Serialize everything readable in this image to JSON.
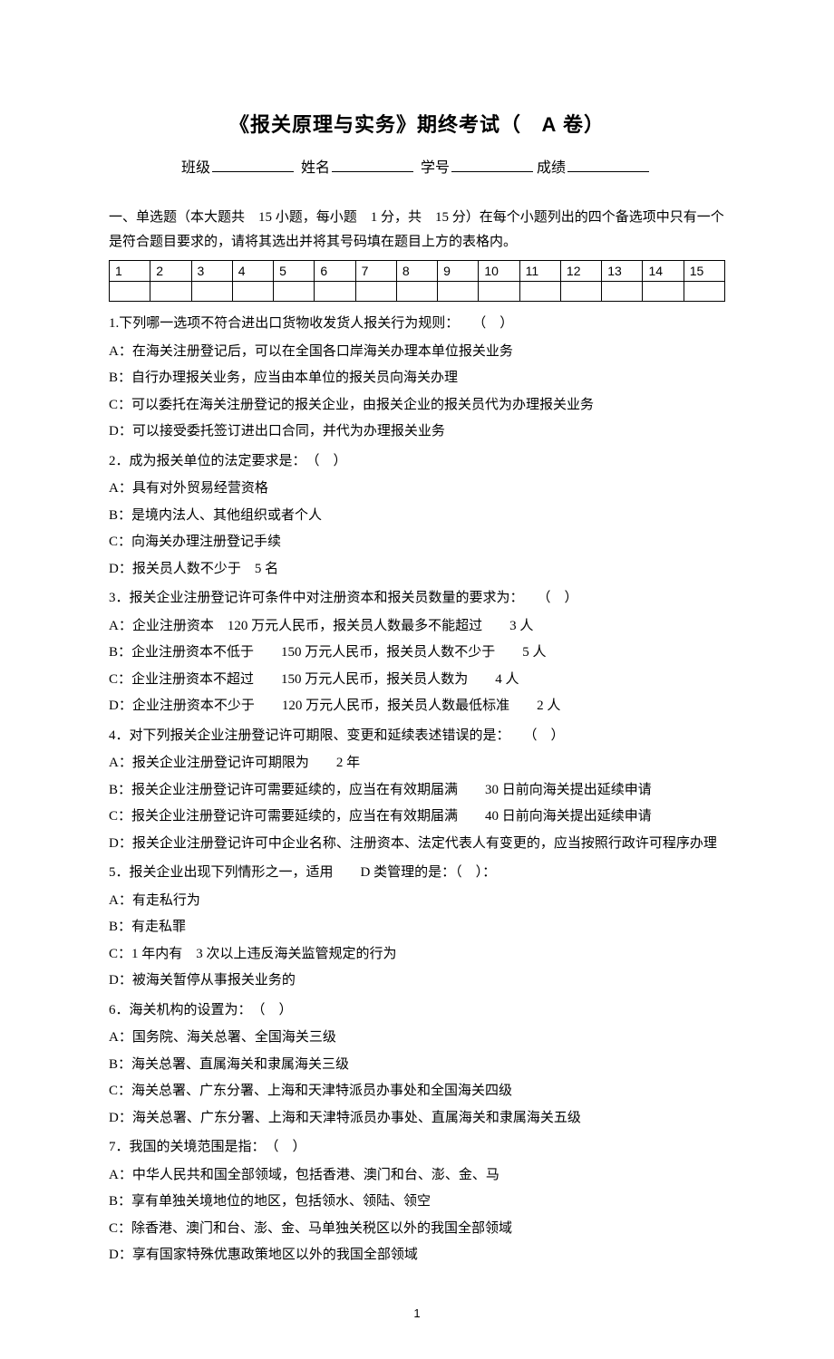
{
  "title_main": "《报关原理与实务》期终考试（",
  "title_paper": "A",
  "title_suffix": "卷）",
  "info": {
    "class_label": "班级",
    "name_label": "姓名",
    "id_label": "学号",
    "score_label": "成绩"
  },
  "section1_intro": "一、单选题（本大题共　15 小题，每小题　1 分，共　15 分）在每个小题列出的四个备选项中只有一个是符合题目要求的，请将其选出并将其号码填在题目上方的表格内。",
  "grid_headers": [
    "1",
    "2",
    "3",
    "4",
    "5",
    "6",
    "7",
    "8",
    "9",
    "10",
    "11",
    "12",
    "13",
    "14",
    "15"
  ],
  "questions": [
    {
      "stem": "1.下列哪一选项不符合进出口货物收发货人报关行为规则：　　（　）",
      "opts": [
        "A：在海关注册登记后，可以在全国各口岸海关办理本单位报关业务",
        "B：自行办理报关业务，应当由本单位的报关员向海关办理",
        "C：可以委托在海关注册登记的报关企业，由报关企业的报关员代为办理报关业务",
        "D：可以接受委托签订进出口合同，并代为办理报关业务"
      ]
    },
    {
      "stem": "2．成为报关单位的法定要求是：　（　）",
      "opts": [
        "A：具有对外贸易经营资格",
        "B：是境内法人、其他组织或者个人",
        "C：向海关办理注册登记手续",
        "D：报关员人数不少于　5 名"
      ]
    },
    {
      "stem": "3．报关企业注册登记许可条件中对注册资本和报关员数量的要求为：　　（　）",
      "opts": [
        "A：企业注册资本　120 万元人民币，报关员人数最多不能超过　　3 人",
        "B：企业注册资本不低于　　150 万元人民币，报关员人数不少于　　5 人",
        "C：企业注册资本不超过　　150 万元人民币，报关员人数为　　4 人",
        "D：企业注册资本不少于　　120 万元人民币，报关员人数最低标准　　2 人"
      ]
    },
    {
      "stem": "4．对下列报关企业注册登记许可期限、变更和延续表述错误的是：　　（　）",
      "opts": [
        "A：报关企业注册登记许可期限为　　2 年",
        "B：报关企业注册登记许可需要延续的，应当在有效期届满　　30 日前向海关提出延续申请",
        "C：报关企业注册登记许可需要延续的，应当在有效期届满　　40 日前向海关提出延续申请",
        "D：报关企业注册登记许可中企业名称、注册资本、法定代表人有变更的，应当按照行政许可程序办理"
      ]
    },
    {
      "stem": "5．报关企业出现下列情形之一，适用　　D 类管理的是：（　）：",
      "opts": [
        "A：有走私行为",
        "B：有走私罪",
        "C：1 年内有　3 次以上违反海关监管规定的行为",
        "D：被海关暂停从事报关业务的"
      ]
    },
    {
      "stem": "6．海关机构的设置为：　（　）",
      "opts": [
        "A：国务院、海关总署、全国海关三级",
        "B：海关总署、直属海关和隶属海关三级",
        "C：海关总署、广东分署、上海和天津特派员办事处和全国海关四级",
        "D：海关总署、广东分署、上海和天津特派员办事处、直属海关和隶属海关五级"
      ]
    },
    {
      "stem": "7．我国的关境范围是指：　（　）",
      "opts": [
        "A：中华人民共和国全部领域，包括香港、澳门和台、澎、金、马",
        "B：享有单独关境地位的地区，包括领水、领陆、领空",
        "C：除香港、澳门和台、澎、金、马单独关税区以外的我国全部领域",
        "D：享有国家特殊优惠政策地区以外的我国全部领域"
      ]
    }
  ],
  "page_number": "1"
}
